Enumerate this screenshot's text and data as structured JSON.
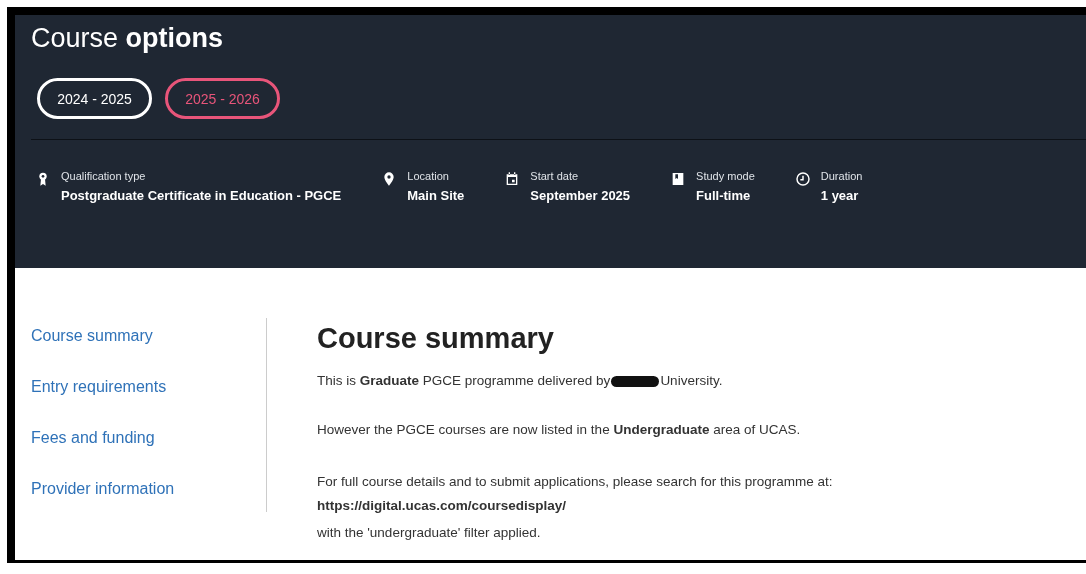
{
  "header": {
    "title_light": "Course",
    "title_bold": "options"
  },
  "years": [
    {
      "label": "2024 - 2025",
      "selected": false
    },
    {
      "label": "2025 - 2026",
      "selected": true
    }
  ],
  "details": [
    {
      "kind": "qualification",
      "label": "Qualification type",
      "value": "Postgraduate Certificate in Education - PGCE"
    },
    {
      "kind": "location",
      "label": "Location",
      "value": "Main Site"
    },
    {
      "kind": "date",
      "label": "Start date",
      "value": "September 2025"
    },
    {
      "kind": "mode",
      "label": "Study mode",
      "value": "Full-time"
    },
    {
      "kind": "duration",
      "label": "Duration",
      "value": "1 year"
    }
  ],
  "sidebar": {
    "items": [
      "Course summary",
      "Entry requirements",
      "Fees and funding",
      "Provider information"
    ]
  },
  "summary": {
    "heading": "Course summary",
    "intro_before": "This is **Graduate** PGCE programme delivered by",
    "intro_after": "University.",
    "paragraph_2": "However the PGCE courses are now listed in the **Undergraduate** area of UCAS.",
    "paragraph_3": "For full course details and to submit applications, please search for this programme at: **https://digital.ucas.com/coursedisplay/**",
    "paragraph_4": "with the 'undergraduate' filter applied."
  }
}
